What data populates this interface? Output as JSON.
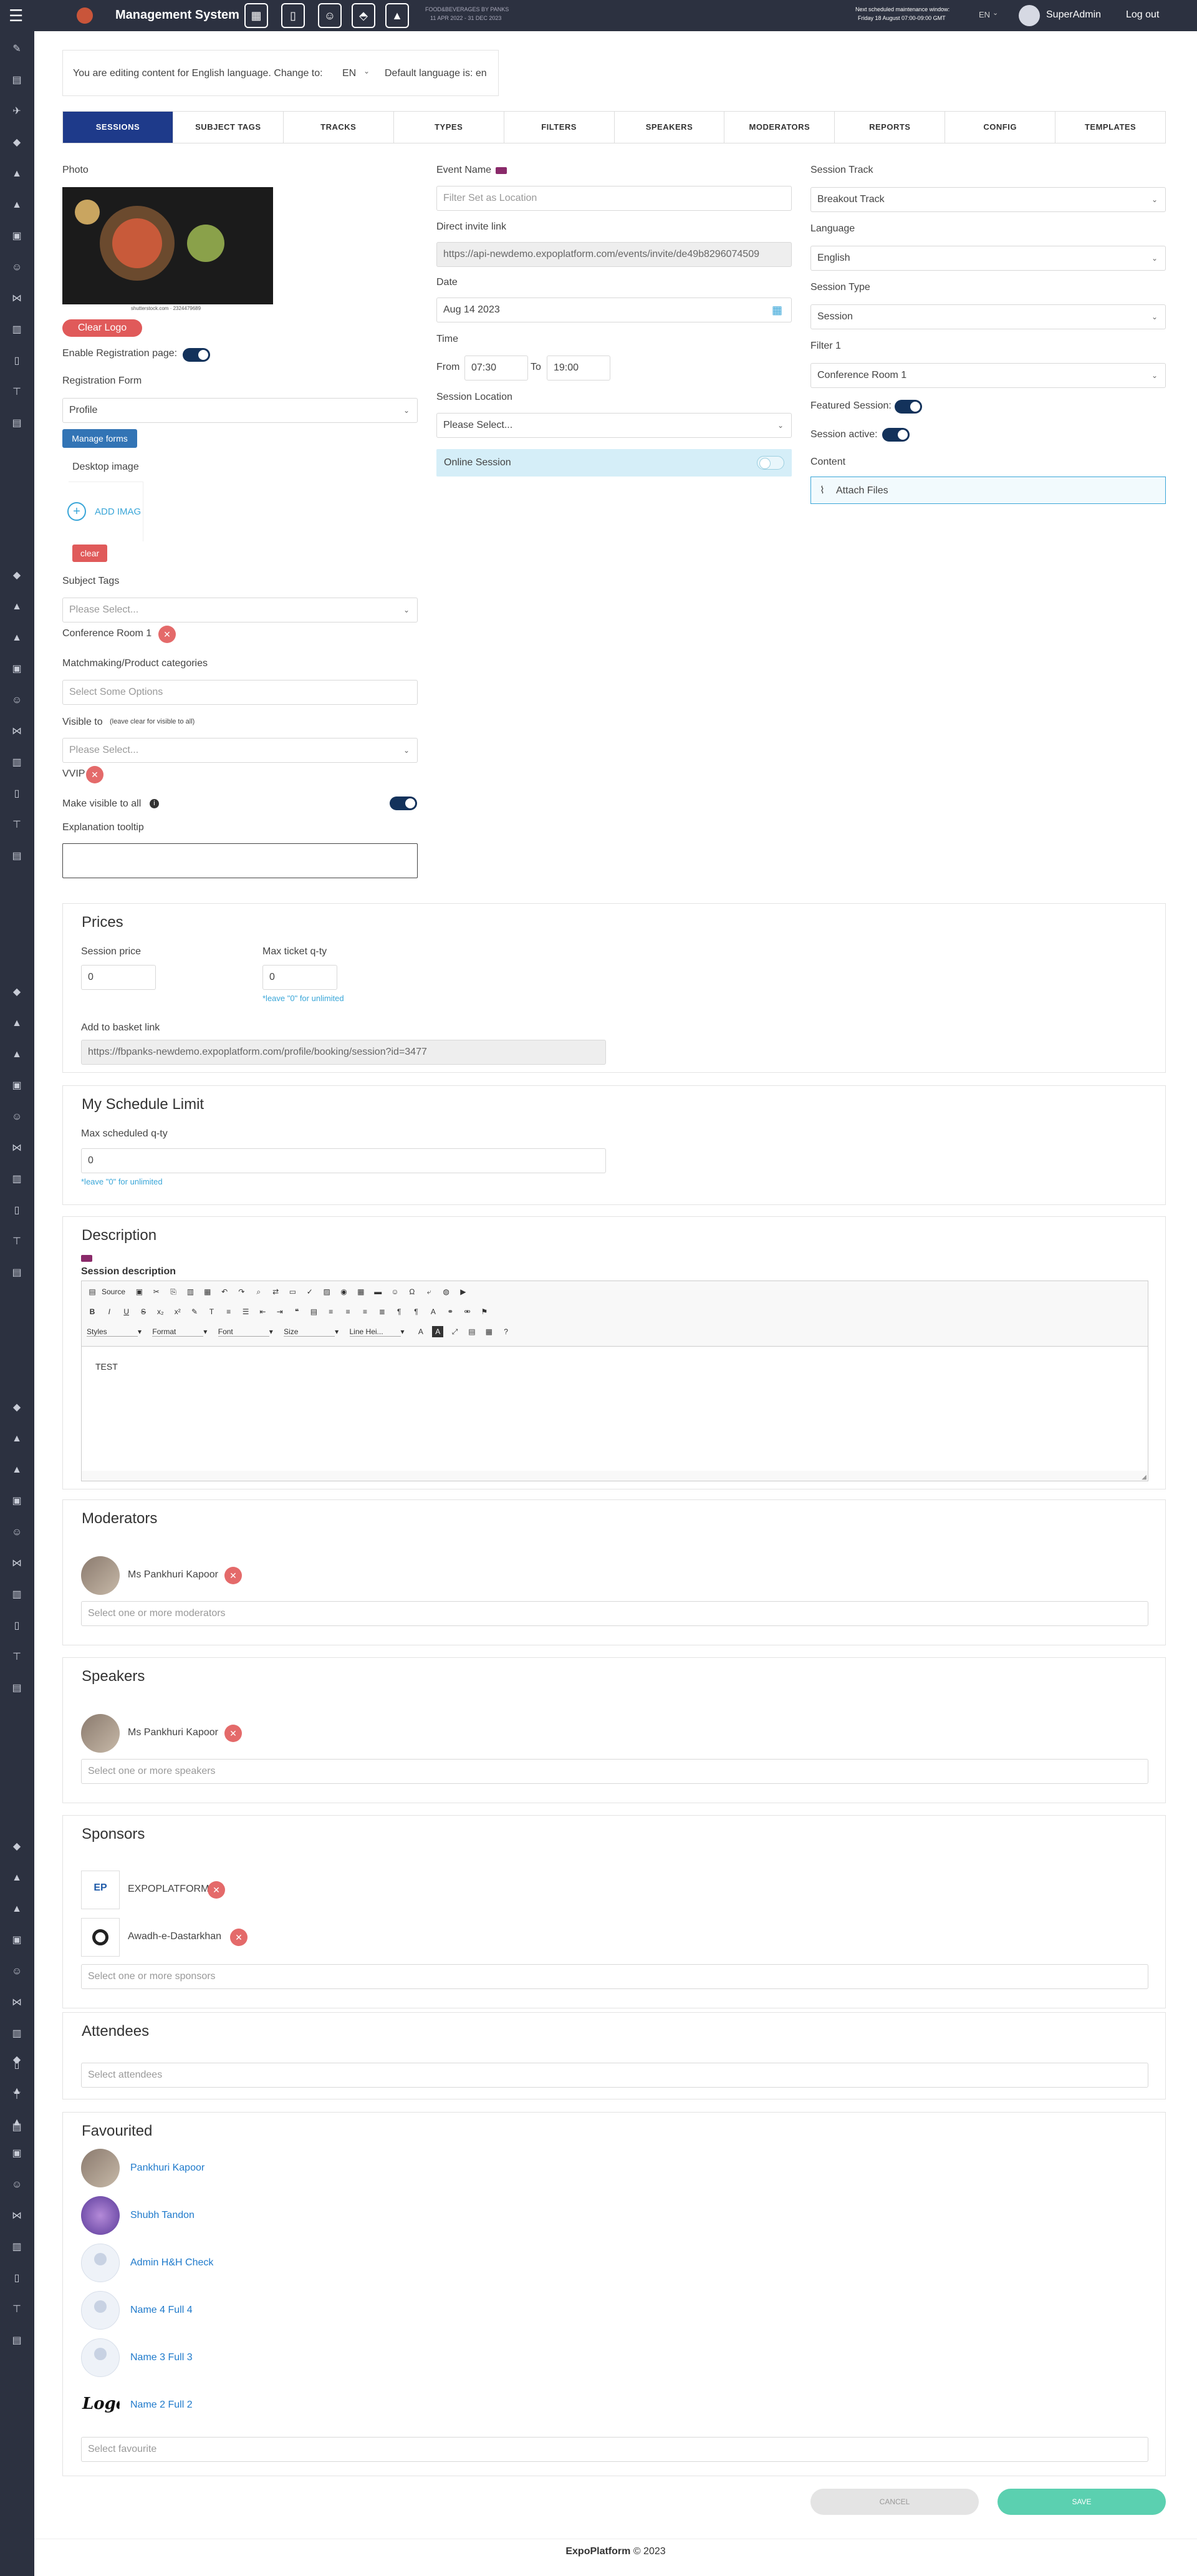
{
  "topbar": {
    "app_title": "Management System",
    "event_name": "FOOD&BEVERAGES BY PANKS",
    "event_dates": "11 APR 2022 - 31 DEC 2023",
    "maintenance_title": "Next scheduled maintenance window:",
    "maintenance_time": "Friday 18 August 07:00-09:00 GMT",
    "language": "EN",
    "user_name": "SuperAdmin",
    "logout": "Log out"
  },
  "language_bar": {
    "text": "You are editing content for English language. Change to:",
    "selected": "EN",
    "default_text": "Default language is: en"
  },
  "tabs": [
    {
      "label": "SESSIONS",
      "active": true
    },
    {
      "label": "SUBJECT TAGS",
      "active": false
    },
    {
      "label": "TRACKS",
      "active": false
    },
    {
      "label": "TYPES",
      "active": false
    },
    {
      "label": "FILTERS",
      "active": false
    },
    {
      "label": "SPEAKERS",
      "active": false
    },
    {
      "label": "MODERATORS",
      "active": false
    },
    {
      "label": "REPORTS",
      "active": false
    },
    {
      "label": "CONFIG",
      "active": false
    },
    {
      "label": "TEMPLATES",
      "active": false
    }
  ],
  "left": {
    "photo_label": "Photo",
    "photo_caption": "shutterstock.com · 2324479689",
    "clear_logo": "Clear Logo",
    "enable_registration": "Enable Registration page:",
    "registration_form_label": "Registration Form",
    "registration_form_value": "Profile",
    "manage_forms": "Manage forms",
    "desktop_image": "Desktop image",
    "add_image": "ADD IMAG",
    "clear": "clear",
    "subject_tags_label": "Subject Tags",
    "subject_tags_placeholder": "Please Select...",
    "subject_tag_chip": "Conference Room 1",
    "matchmaking_label": "Matchmaking/Product categories",
    "matchmaking_placeholder": "Select Some Options",
    "visible_to_label": "Visible to",
    "visible_to_hint": "(leave clear for visible to all)",
    "visible_to_placeholder": "Please Select...",
    "visible_chip": "VVIP",
    "make_visible_all": "Make visible to all",
    "explanation_tooltip": "Explanation tooltip"
  },
  "middle": {
    "event_name_label": "Event Name",
    "event_name_placeholder": "Filter Set as Location",
    "direct_invite_label": "Direct invite link",
    "direct_invite_value": "https://api-newdemo.expoplatform.com/events/invite/de49b8296074509",
    "date_label": "Date",
    "date_value": "Aug 14 2023",
    "time_label": "Time",
    "from_label": "From",
    "from_value": "07:30",
    "to_label": "To",
    "to_value": "19:00",
    "session_location_label": "Session Location",
    "session_location_placeholder": "Please Select...",
    "online_session": "Online Session"
  },
  "right": {
    "session_track_label": "Session Track",
    "session_track_value": "Breakout Track",
    "language_label": "Language",
    "language_value": "English",
    "session_type_label": "Session Type",
    "session_type_value": "Session",
    "filter1_label": "Filter 1",
    "filter1_value": "Conference Room 1",
    "featured_label": "Featured Session:",
    "active_label": "Session active:",
    "content_label": "Content",
    "attach_files": "Attach Files"
  },
  "prices": {
    "title": "Prices",
    "session_price_label": "Session price",
    "session_price": "0",
    "max_ticket_label": "Max ticket q-ty",
    "max_ticket": "0",
    "max_ticket_hint": "*leave \"0\" for unlimited",
    "basket_label": "Add to basket link",
    "basket_link": "https://fbpanks-newdemo.expoplatform.com/profile/booking/session?id=3477"
  },
  "schedule": {
    "title": "My Schedule Limit",
    "max_label": "Max scheduled q-ty",
    "max_value": "0",
    "hint": "*leave \"0\" for unlimited"
  },
  "description": {
    "title": "Description",
    "session_desc_label": "Session description",
    "source": "Source",
    "styles": "Styles",
    "format": "Format",
    "font": "Font",
    "size": "Size",
    "line_height": "Line Hei...",
    "body_text": "TEST"
  },
  "moderators": {
    "title": "Moderators",
    "items": [
      {
        "name": "Ms Pankhuri Kapoor"
      }
    ],
    "placeholder": "Select one or more moderators"
  },
  "speakers": {
    "title": "Speakers",
    "items": [
      {
        "name": "Ms Pankhuri Kapoor"
      }
    ],
    "placeholder": "Select one or more speakers"
  },
  "sponsors": {
    "title": "Sponsors",
    "items": [
      {
        "name": "EXPOPLATFORM",
        "logo_text": "EP"
      },
      {
        "name": "Awadh-e-Dastarkhan",
        "logo_text": ""
      }
    ],
    "placeholder": "Select one or more sponsors"
  },
  "attendees": {
    "title": "Attendees",
    "placeholder": "Select attendees"
  },
  "favourited": {
    "title": "Favourited",
    "items": [
      {
        "name": "Pankhuri Kapoor"
      },
      {
        "name": "Shubh Tandon"
      },
      {
        "name": "Admin H&H Check"
      },
      {
        "name": "Name 4 Full 4"
      },
      {
        "name": "Name 3 Full 3"
      },
      {
        "name": "Name 2 Full 2"
      }
    ],
    "logo_text": "Logo",
    "placeholder": "Select favourite"
  },
  "actions": {
    "cancel": "CANCEL",
    "save": "SAVE"
  },
  "footer": {
    "brand": "ExpoPlatform",
    "copyright": "© 2023"
  },
  "colors": {
    "sidebar": "#2c3140",
    "active_tab": "#1e3a8a",
    "toggle_on": "#13325b",
    "save": "#5bd0b0",
    "danger": "#e05a5a",
    "link": "#1f7acb"
  }
}
